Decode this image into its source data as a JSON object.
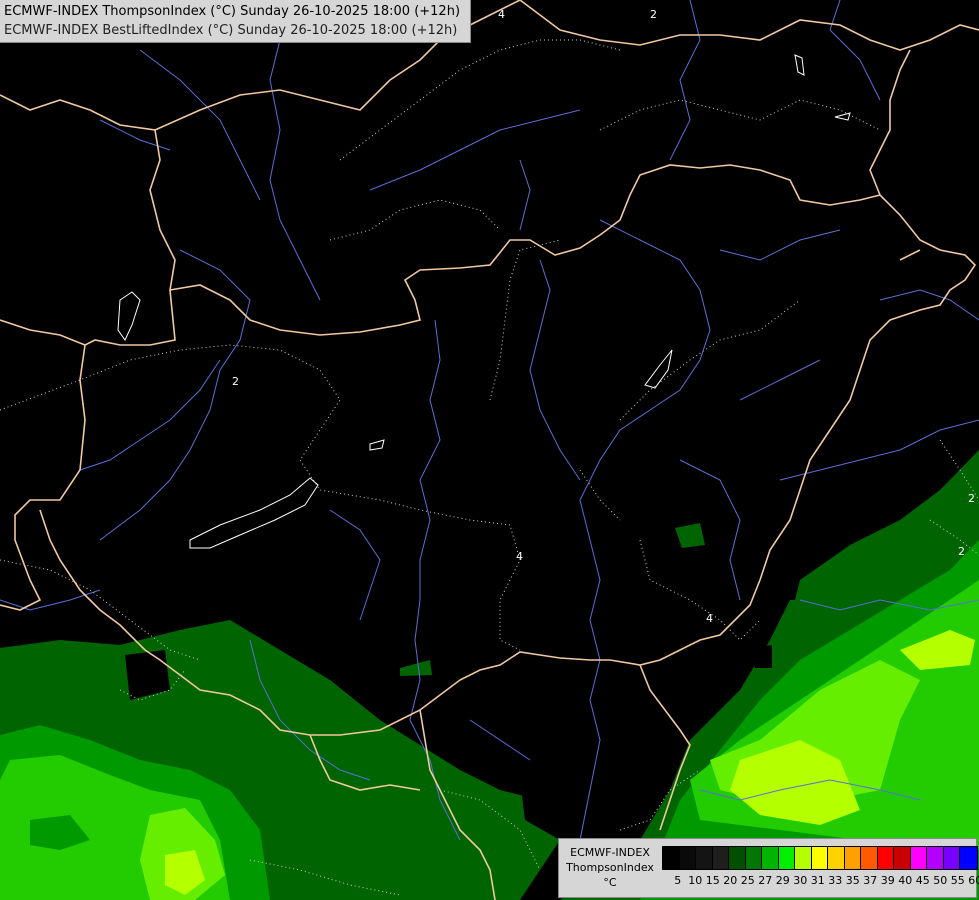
{
  "title": {
    "line1": "ECMWF-INDEX ThompsonIndex (°C) Sunday 26-10-2025 18:00 (+12h)",
    "line2": "ECMWF-INDEX BestLiftedIndex (°C) Sunday 26-10-2025 18:00 (+12h)"
  },
  "contour_labels": [
    "2",
    "2",
    "4",
    "4",
    "2",
    "2",
    "4"
  ],
  "legend": {
    "line1": "ECMWF-INDEX",
    "line2": "ThompsonIndex",
    "line3": "°C",
    "ticks": [
      "5",
      "10",
      "15",
      "20",
      "25",
      "27",
      "29",
      "30",
      "31",
      "33",
      "35",
      "37",
      "39",
      "40",
      "45",
      "50",
      "55",
      "60"
    ],
    "colors": [
      "#000000",
      "#0a0a0a",
      "#141414",
      "#1e1e1e",
      "#005000",
      "#007800",
      "#00b400",
      "#00ee00",
      "#b4ff00",
      "#ffff00",
      "#ffd200",
      "#ffa000",
      "#ff5a00",
      "#ff0000",
      "#c80000",
      "#ff00ff",
      "#b400ff",
      "#7800ff",
      "#0000ff"
    ]
  },
  "colors": {
    "country_border": "#f0c9a0",
    "river": "#5a6fd6",
    "dark_green": "#006400",
    "mid_green": "#00a000",
    "bright_green": "#33dd00",
    "yellow_green": "#b4ff00"
  }
}
